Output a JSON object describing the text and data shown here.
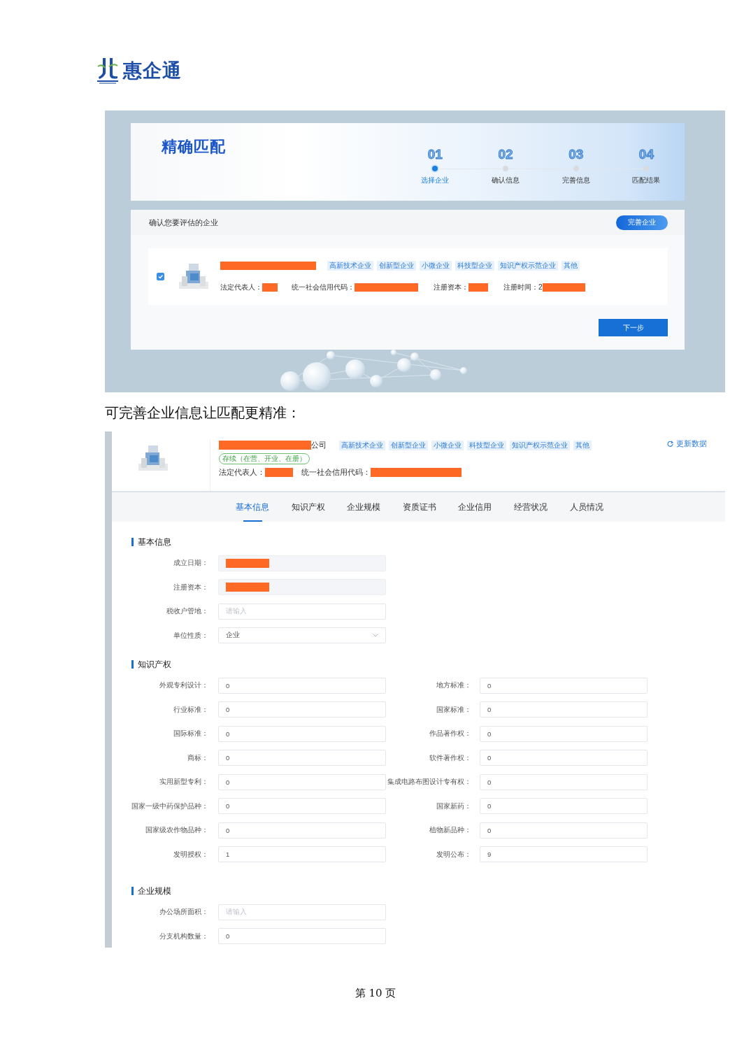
{
  "logo": {
    "name": "惠企通"
  },
  "match": {
    "title": "精确匹配",
    "steps": [
      {
        "number": "01",
        "label": "选择企业",
        "selected": true
      },
      {
        "number": "02",
        "label": "确认信息",
        "selected": false
      },
      {
        "number": "03",
        "label": "完善信息",
        "selected": false
      },
      {
        "number": "04",
        "label": "匹配结果",
        "selected": false
      }
    ],
    "section_title": "确认您要评估的企业",
    "complete_button": "完善企业",
    "company": {
      "checked": true,
      "tags": [
        "高新技术企业",
        "创新型企业",
        "小微企业",
        "科技型企业",
        "知识产权示范企业",
        "其他"
      ],
      "fields": [
        {
          "label": "法定代表人："
        },
        {
          "label": "统一社会信用代码："
        },
        {
          "label": "注册资本："
        },
        {
          "label": "注册时间：2"
        }
      ]
    },
    "next_button": "下一步"
  },
  "note": "可完善企业信息让匹配更精准：",
  "profile": {
    "name_suffix": "公司",
    "tags": [
      "高新技术企业",
      "创新型企业",
      "小微企业",
      "科技型企业",
      "知识产权示范企业",
      "其他"
    ],
    "status": "存续（在营、开业、在册）",
    "fields": [
      {
        "label": "法定代表人："
      },
      {
        "label": "统一社会信用代码："
      }
    ],
    "refresh": "更新数据",
    "tabs": [
      {
        "label": "基本信息",
        "selected": true
      },
      {
        "label": "知识产权",
        "selected": false
      },
      {
        "label": "企业规模",
        "selected": false
      },
      {
        "label": "资质证书",
        "selected": false
      },
      {
        "label": "企业信用",
        "selected": false
      },
      {
        "label": "经营状况",
        "selected": false
      },
      {
        "label": "人员情况",
        "selected": false
      }
    ],
    "sections": [
      {
        "title": "基本信息",
        "two_column": false,
        "fields": [
          {
            "label": "成立日期：",
            "kind": "redacted"
          },
          {
            "label": "注册资本：",
            "kind": "redacted"
          },
          {
            "label": "税收户管地：",
            "kind": "empty",
            "placeholder": "请输入"
          },
          {
            "label": "单位性质：",
            "kind": "select",
            "value": "企业"
          }
        ]
      },
      {
        "title": "知识产权",
        "two_column": true,
        "fields": [
          {
            "label": "外观专利设计：",
            "kind": "text",
            "value": "0"
          },
          {
            "label": "地方标准：",
            "kind": "text",
            "value": "0"
          },
          {
            "label": "行业标准：",
            "kind": "text",
            "value": "0"
          },
          {
            "label": "国家标准：",
            "kind": "text",
            "value": "0"
          },
          {
            "label": "国际标准：",
            "kind": "text",
            "value": "0"
          },
          {
            "label": "作品著作权：",
            "kind": "text",
            "value": "0"
          },
          {
            "label": "商标：",
            "kind": "text",
            "value": "0"
          },
          {
            "label": "软件著作权：",
            "kind": "text",
            "value": "0"
          },
          {
            "label": "实用新型专利：",
            "kind": "text",
            "value": "0"
          },
          {
            "label": "集成电路布图设计专有权：",
            "kind": "text",
            "value": "0"
          },
          {
            "label": "国家一级中药保护品种：",
            "kind": "text",
            "value": "0"
          },
          {
            "label": "国家新药：",
            "kind": "text",
            "value": "0"
          },
          {
            "label": "国家级农作物品种：",
            "kind": "text",
            "value": "0"
          },
          {
            "label": "植物新品种：",
            "kind": "text",
            "value": "0"
          },
          {
            "label": "发明授权：",
            "kind": "text",
            "value": "1"
          },
          {
            "label": "发明公布：",
            "kind": "text",
            "value": "9"
          }
        ]
      },
      {
        "title": "企业规模",
        "two_column": false,
        "fields": [
          {
            "label": "办公场所面积：",
            "kind": "empty",
            "placeholder": "请输入"
          },
          {
            "label": "分支机构数量：",
            "kind": "text",
            "value": "0"
          }
        ]
      }
    ]
  },
  "footer": "第 10 页"
}
